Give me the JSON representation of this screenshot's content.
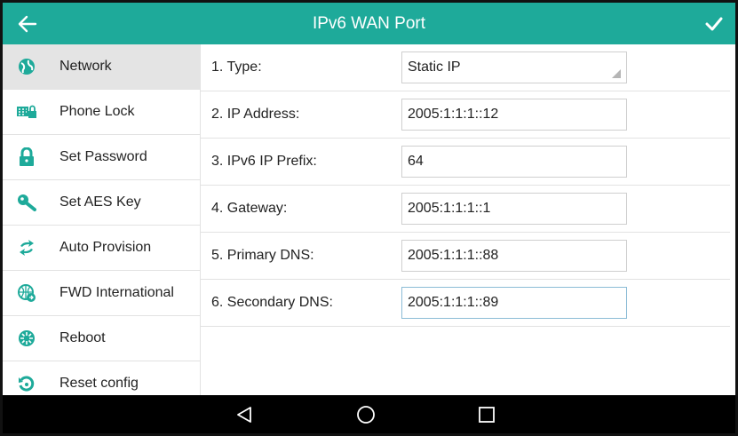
{
  "header": {
    "title": "IPv6 WAN Port",
    "back_icon": "arrow-left-icon",
    "confirm_icon": "checkmark-icon"
  },
  "sidebar": {
    "items": [
      {
        "label": "Network",
        "icon": "globe-icon",
        "active": true
      },
      {
        "label": "Phone Lock",
        "icon": "keypad-lock-icon",
        "active": false
      },
      {
        "label": "Set Password",
        "icon": "padlock-icon",
        "active": false
      },
      {
        "label": "Set AES Key",
        "icon": "key-icon",
        "active": false
      },
      {
        "label": "Auto Provision",
        "icon": "sync-arrows-icon",
        "active": false
      },
      {
        "label": "FWD International",
        "icon": "international-globe-icon",
        "active": false
      },
      {
        "label": "Reboot",
        "icon": "reboot-icon",
        "active": false
      },
      {
        "label": "Reset config",
        "icon": "reset-icon",
        "active": false
      }
    ]
  },
  "form": {
    "rows": [
      {
        "label": "1. Type:",
        "value": "Static IP",
        "kind": "select"
      },
      {
        "label": "2. IP Address:",
        "value": "2005:1:1:1::12",
        "kind": "input"
      },
      {
        "label": "3. IPv6 IP Prefix:",
        "value": "64",
        "kind": "input"
      },
      {
        "label": "4. Gateway:",
        "value": "2005:1:1:1::1",
        "kind": "input"
      },
      {
        "label": "5. Primary DNS:",
        "value": "2005:1:1:1::88",
        "kind": "input"
      },
      {
        "label": "6. Secondary DNS:",
        "value": "2005:1:1:1::89",
        "kind": "input",
        "focused": true
      }
    ]
  },
  "navbar": {
    "back_icon": "triangle-back-icon",
    "home_icon": "circle-home-icon",
    "recent_icon": "square-recent-icon"
  },
  "colors": {
    "accent": "#1eaa9a",
    "nav_bg": "#000000"
  }
}
